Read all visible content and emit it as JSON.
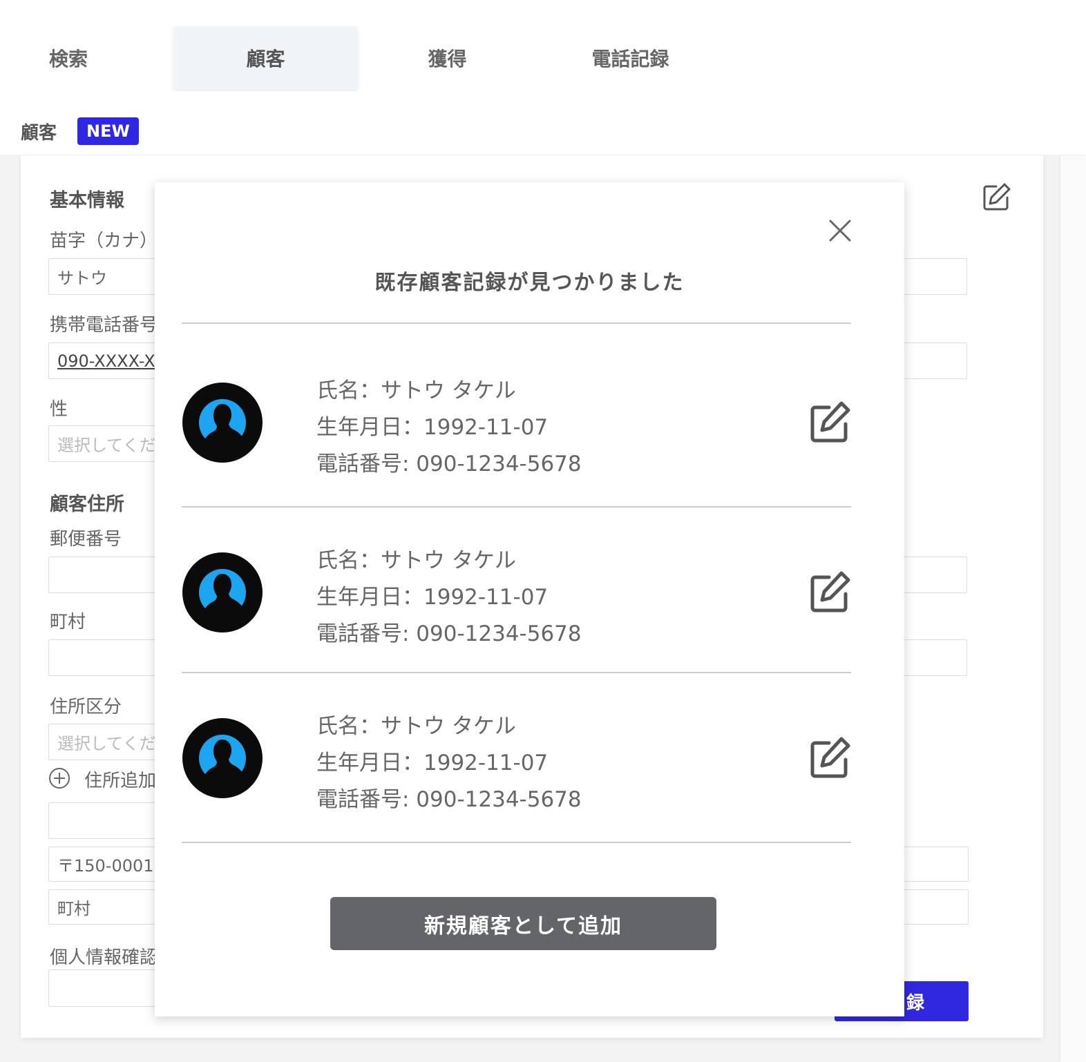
{
  "tabs": [
    {
      "label": "検索"
    },
    {
      "label": "顧客"
    },
    {
      "label": "獲得"
    },
    {
      "label": "電話記録"
    }
  ],
  "section": {
    "title": "顧客",
    "badge": "NEW"
  },
  "form": {
    "basic_info_header": "基本情報",
    "surname_kana_label": "苗字（カナ）",
    "surname_kana_value": "サトウ",
    "mobile_label": "携帯電話番号",
    "mobile_value": "090-XXXX-X",
    "gender_label": "性",
    "gender_placeholder": "選択してくだ",
    "address_header": "顧客住所",
    "postal_label": "郵便番号",
    "town_label": "町村",
    "address_type_label": "住所区分",
    "address_type_placeholder": "選択してくだ",
    "add_address_label": "住所追加",
    "saved_postal": "〒150-0001",
    "saved_town": "町村",
    "privacy_label": "個人情報確認",
    "register_button": "録"
  },
  "modal": {
    "title": "既存顧客記録が見つかりました",
    "records": [
      {
        "name": "氏名：サトウ タケル",
        "dob": "生年月日：1992-11-07",
        "phone": "電話番号: 090-1234-5678"
      },
      {
        "name": "氏名：サトウ タケル",
        "dob": "生年月日：1992-11-07",
        "phone": "電話番号: 090-1234-5678"
      },
      {
        "name": "氏名：サトウ タケル",
        "dob": "生年月日：1992-11-07",
        "phone": "電話番号: 090-1234-5678"
      }
    ],
    "add_new_button": "新規顧客として追加"
  },
  "colors": {
    "accent": "#2f28e0",
    "button_gray": "#636569",
    "avatar_ring": "#1ea5f2"
  },
  "icons": [
    "close-icon",
    "edit-icon",
    "avatar-icon",
    "plus-circle-icon"
  ]
}
